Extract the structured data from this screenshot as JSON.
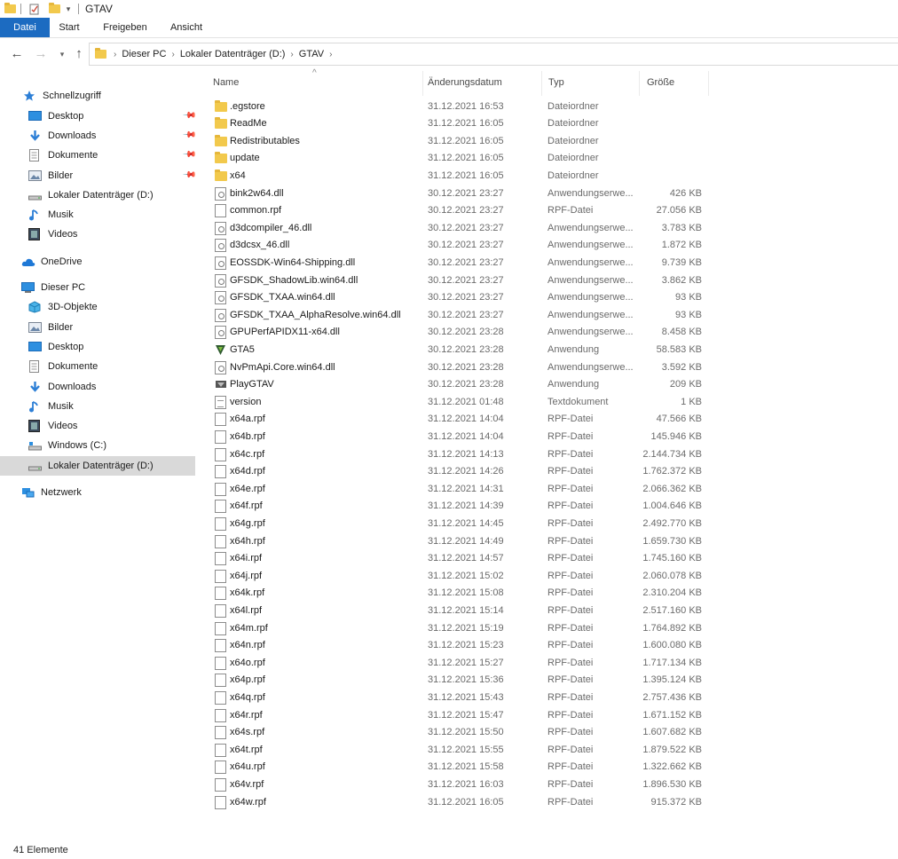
{
  "window": {
    "title": "GTAV"
  },
  "ribbon": {
    "tabs": [
      "Datei",
      "Start",
      "Freigeben",
      "Ansicht"
    ]
  },
  "address": {
    "crumbs": [
      "Dieser PC",
      "Lokaler Datenträger (D:)",
      "GTAV"
    ]
  },
  "sidebar": {
    "quick_access": "Schnellzugriff",
    "quick_items": [
      "Desktop",
      "Downloads",
      "Dokumente",
      "Bilder",
      "Lokaler Datenträger (D:)",
      "Musik",
      "Videos"
    ],
    "onedrive": "OneDrive",
    "this_pc": "Dieser PC",
    "pc_items": [
      "3D-Objekte",
      "Bilder",
      "Desktop",
      "Dokumente",
      "Downloads",
      "Musik",
      "Videos",
      "Windows (C:)",
      "Lokaler Datenträger (D:)"
    ],
    "network": "Netzwerk"
  },
  "columns": {
    "name": "Name",
    "date": "Änderungsdatum",
    "type": "Typ",
    "size": "Größe"
  },
  "files": [
    {
      "name": ".egstore",
      "date": "31.12.2021 16:53",
      "type": "Dateiordner",
      "size": "",
      "icon": "folder"
    },
    {
      "name": "ReadMe",
      "date": "31.12.2021 16:05",
      "type": "Dateiordner",
      "size": "",
      "icon": "folder"
    },
    {
      "name": "Redistributables",
      "date": "31.12.2021 16:05",
      "type": "Dateiordner",
      "size": "",
      "icon": "folder"
    },
    {
      "name": "update",
      "date": "31.12.2021 16:05",
      "type": "Dateiordner",
      "size": "",
      "icon": "folder"
    },
    {
      "name": "x64",
      "date": "31.12.2021 16:05",
      "type": "Dateiordner",
      "size": "",
      "icon": "folder"
    },
    {
      "name": "bink2w64.dll",
      "date": "30.12.2021 23:27",
      "type": "Anwendungserwe...",
      "size": "426 KB",
      "icon": "dll"
    },
    {
      "name": "common.rpf",
      "date": "30.12.2021 23:27",
      "type": "RPF-Datei",
      "size": "27.056 KB",
      "icon": "file"
    },
    {
      "name": "d3dcompiler_46.dll",
      "date": "30.12.2021 23:27",
      "type": "Anwendungserwe...",
      "size": "3.783 KB",
      "icon": "dll"
    },
    {
      "name": "d3dcsx_46.dll",
      "date": "30.12.2021 23:27",
      "type": "Anwendungserwe...",
      "size": "1.872 KB",
      "icon": "dll"
    },
    {
      "name": "EOSSDK-Win64-Shipping.dll",
      "date": "30.12.2021 23:27",
      "type": "Anwendungserwe...",
      "size": "9.739 KB",
      "icon": "dll"
    },
    {
      "name": "GFSDK_ShadowLib.win64.dll",
      "date": "30.12.2021 23:27",
      "type": "Anwendungserwe...",
      "size": "3.862 KB",
      "icon": "dll"
    },
    {
      "name": "GFSDK_TXAA.win64.dll",
      "date": "30.12.2021 23:27",
      "type": "Anwendungserwe...",
      "size": "93 KB",
      "icon": "dll"
    },
    {
      "name": "GFSDK_TXAA_AlphaResolve.win64.dll",
      "date": "30.12.2021 23:27",
      "type": "Anwendungserwe...",
      "size": "93 KB",
      "icon": "dll"
    },
    {
      "name": "GPUPerfAPIDX11-x64.dll",
      "date": "30.12.2021 23:28",
      "type": "Anwendungserwe...",
      "size": "8.458 KB",
      "icon": "dll"
    },
    {
      "name": "GTA5",
      "date": "30.12.2021 23:28",
      "type": "Anwendung",
      "size": "58.583 KB",
      "icon": "gta"
    },
    {
      "name": "NvPmApi.Core.win64.dll",
      "date": "30.12.2021 23:28",
      "type": "Anwendungserwe...",
      "size": "3.592 KB",
      "icon": "dll"
    },
    {
      "name": "PlayGTAV",
      "date": "30.12.2021 23:28",
      "type": "Anwendung",
      "size": "209 KB",
      "icon": "play"
    },
    {
      "name": "version",
      "date": "31.12.2021 01:48",
      "type": "Textdokument",
      "size": "1 KB",
      "icon": "text"
    },
    {
      "name": "x64a.rpf",
      "date": "31.12.2021 14:04",
      "type": "RPF-Datei",
      "size": "47.566 KB",
      "icon": "file"
    },
    {
      "name": "x64b.rpf",
      "date": "31.12.2021 14:04",
      "type": "RPF-Datei",
      "size": "145.946 KB",
      "icon": "file"
    },
    {
      "name": "x64c.rpf",
      "date": "31.12.2021 14:13",
      "type": "RPF-Datei",
      "size": "2.144.734 KB",
      "icon": "file"
    },
    {
      "name": "x64d.rpf",
      "date": "31.12.2021 14:26",
      "type": "RPF-Datei",
      "size": "1.762.372 KB",
      "icon": "file"
    },
    {
      "name": "x64e.rpf",
      "date": "31.12.2021 14:31",
      "type": "RPF-Datei",
      "size": "2.066.362 KB",
      "icon": "file"
    },
    {
      "name": "x64f.rpf",
      "date": "31.12.2021 14:39",
      "type": "RPF-Datei",
      "size": "1.004.646 KB",
      "icon": "file"
    },
    {
      "name": "x64g.rpf",
      "date": "31.12.2021 14:45",
      "type": "RPF-Datei",
      "size": "2.492.770 KB",
      "icon": "file"
    },
    {
      "name": "x64h.rpf",
      "date": "31.12.2021 14:49",
      "type": "RPF-Datei",
      "size": "1.659.730 KB",
      "icon": "file"
    },
    {
      "name": "x64i.rpf",
      "date": "31.12.2021 14:57",
      "type": "RPF-Datei",
      "size": "1.745.160 KB",
      "icon": "file"
    },
    {
      "name": "x64j.rpf",
      "date": "31.12.2021 15:02",
      "type": "RPF-Datei",
      "size": "2.060.078 KB",
      "icon": "file"
    },
    {
      "name": "x64k.rpf",
      "date": "31.12.2021 15:08",
      "type": "RPF-Datei",
      "size": "2.310.204 KB",
      "icon": "file"
    },
    {
      "name": "x64l.rpf",
      "date": "31.12.2021 15:14",
      "type": "RPF-Datei",
      "size": "2.517.160 KB",
      "icon": "file"
    },
    {
      "name": "x64m.rpf",
      "date": "31.12.2021 15:19",
      "type": "RPF-Datei",
      "size": "1.764.892 KB",
      "icon": "file"
    },
    {
      "name": "x64n.rpf",
      "date": "31.12.2021 15:23",
      "type": "RPF-Datei",
      "size": "1.600.080 KB",
      "icon": "file"
    },
    {
      "name": "x64o.rpf",
      "date": "31.12.2021 15:27",
      "type": "RPF-Datei",
      "size": "1.717.134 KB",
      "icon": "file"
    },
    {
      "name": "x64p.rpf",
      "date": "31.12.2021 15:36",
      "type": "RPF-Datei",
      "size": "1.395.124 KB",
      "icon": "file"
    },
    {
      "name": "x64q.rpf",
      "date": "31.12.2021 15:43",
      "type": "RPF-Datei",
      "size": "2.757.436 KB",
      "icon": "file"
    },
    {
      "name": "x64r.rpf",
      "date": "31.12.2021 15:47",
      "type": "RPF-Datei",
      "size": "1.671.152 KB",
      "icon": "file"
    },
    {
      "name": "x64s.rpf",
      "date": "31.12.2021 15:50",
      "type": "RPF-Datei",
      "size": "1.607.682 KB",
      "icon": "file"
    },
    {
      "name": "x64t.rpf",
      "date": "31.12.2021 15:55",
      "type": "RPF-Datei",
      "size": "1.879.522 KB",
      "icon": "file"
    },
    {
      "name": "x64u.rpf",
      "date": "31.12.2021 15:58",
      "type": "RPF-Datei",
      "size": "1.322.662 KB",
      "icon": "file"
    },
    {
      "name": "x64v.rpf",
      "date": "31.12.2021 16:03",
      "type": "RPF-Datei",
      "size": "1.896.530 KB",
      "icon": "file"
    },
    {
      "name": "x64w.rpf",
      "date": "31.12.2021 16:05",
      "type": "RPF-Datei",
      "size": "915.372 KB",
      "icon": "file"
    }
  ],
  "status": {
    "count": "41 Elemente"
  },
  "colors": {
    "accent": "#1c6bc1",
    "folder": "#f2c94c",
    "selected": "#d9d9d9"
  }
}
